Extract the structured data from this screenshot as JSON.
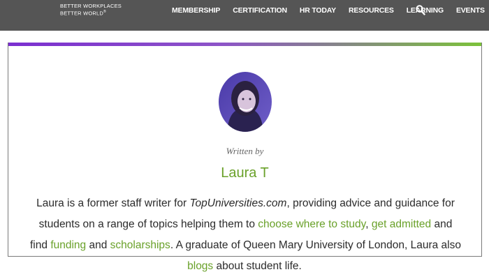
{
  "header": {
    "brand_line1": "BETTER WORKPLACES",
    "brand_line2": "BETTER WORLD",
    "brand_mark": "®",
    "nav": [
      {
        "label": "MEMBERSHIP"
      },
      {
        "label": "CERTIFICATION"
      },
      {
        "label": "HR TODAY"
      },
      {
        "label": "RESOURCES"
      },
      {
        "label": "LEARNING"
      },
      {
        "label": "EVENTS"
      }
    ],
    "search_icon": "search-icon",
    "bar_color": "#555555"
  },
  "author": {
    "written_by": "Written by",
    "name": "Laura T",
    "bio": {
      "line1": "Laura is a former staff writer for ",
      "site": "TopUniversities.com",
      "line1_end": ", providing advice and guidance for",
      "line2_start": "students on a range of topics helping them to ",
      "link_study": "choose where to study",
      "comma": ", ",
      "link_admitted": "get admitted",
      "line2_end": " and",
      "line3_start": "find ",
      "link_funding": "funding",
      "and": " and ",
      "link_scholarships": "scholarships",
      "line3_end": ". A graduate of Queen Mary University of London, Laura also",
      "link_blogs": "blogs",
      "line4_end": " about student life."
    },
    "accent_colors": [
      "#7b2fd0",
      "#7cc23a"
    ],
    "link_color": "#6aa12a"
  }
}
